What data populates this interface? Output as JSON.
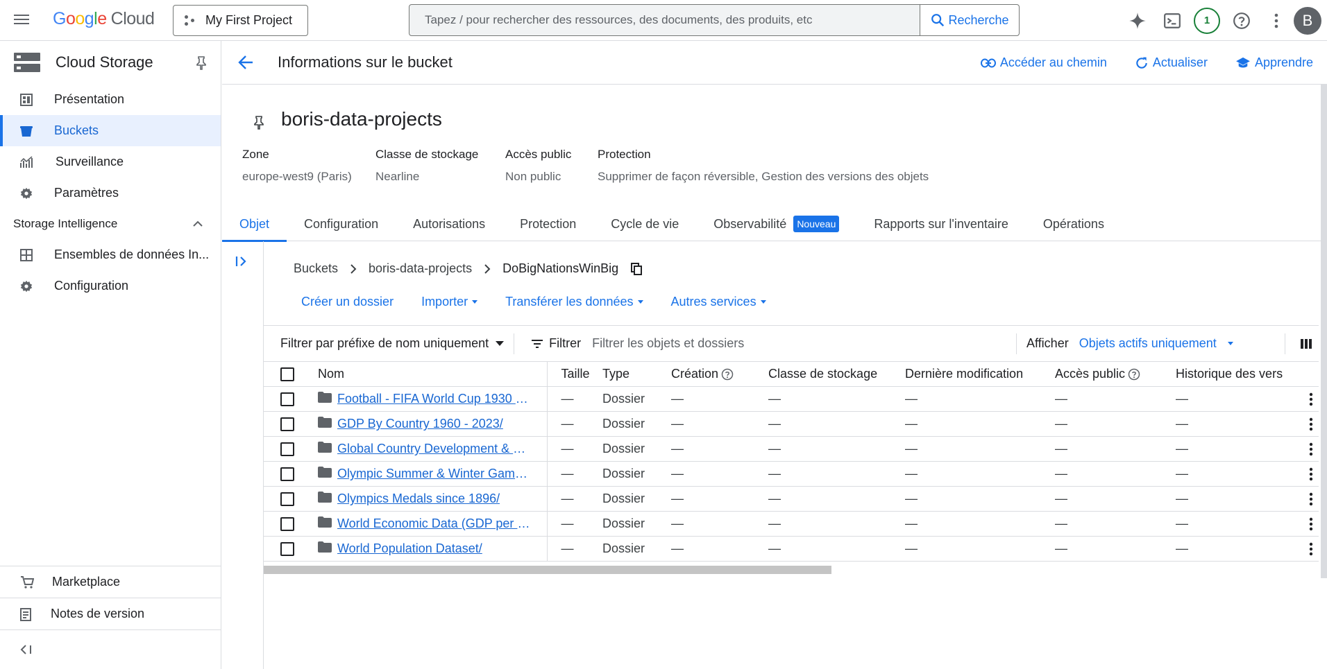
{
  "topbar": {
    "logo_letters": [
      "G",
      "o",
      "o",
      "g",
      "l",
      "e"
    ],
    "logo_suffix": "Cloud",
    "project": "My First Project",
    "search_placeholder": "Tapez / pour rechercher des ressources, des documents, des produits, etc",
    "search_button": "Recherche",
    "notifications_count": "1",
    "avatar_letter": "B"
  },
  "sidebar": {
    "title": "Cloud Storage",
    "items": [
      {
        "label": "Présentation",
        "icon": "dashboard-icon"
      },
      {
        "label": "Buckets",
        "icon": "bucket-icon",
        "active": true
      },
      {
        "label": "Surveillance",
        "icon": "monitoring-icon"
      },
      {
        "label": "Paramètres",
        "icon": "gear-icon"
      }
    ],
    "section": "Storage Intelligence",
    "section_items": [
      {
        "label": "Ensembles de données In...",
        "icon": "dataset-icon"
      },
      {
        "label": "Configuration",
        "icon": "gear-icon"
      }
    ],
    "bottom": [
      {
        "label": "Marketplace",
        "icon": "cart-icon"
      },
      {
        "label": "Notes de version",
        "icon": "notes-icon"
      }
    ]
  },
  "header": {
    "title": "Informations sur le bucket",
    "actions": [
      "Accéder au chemin",
      "Actualiser",
      "Apprendre"
    ]
  },
  "bucket": {
    "name": "boris-data-projects",
    "props": [
      {
        "key": "Zone",
        "value": "europe-west9 (Paris)"
      },
      {
        "key": "Classe de stockage",
        "value": "Nearline"
      },
      {
        "key": "Accès public",
        "value": "Non public"
      },
      {
        "key": "Protection",
        "value": "Supprimer de façon réversible, Gestion des versions des objets"
      }
    ]
  },
  "tabs": [
    "Objet",
    "Configuration",
    "Autorisations",
    "Protection",
    "Cycle de vie",
    "Observabilité",
    "Rapports sur l'inventaire",
    "Opérations"
  ],
  "tab_new_badge": "Nouveau",
  "breadcrumb": [
    "Buckets",
    "boris-data-projects",
    "DoBigNationsWinBig"
  ],
  "object_actions": [
    "Créer un dossier",
    "Importer",
    "Transférer les données",
    "Autres services"
  ],
  "filter": {
    "prefix": "Filtrer par préfixe de nom uniquement",
    "label": "Filtrer",
    "placeholder": "Filtrer les objets et dossiers",
    "show_label": "Afficher",
    "show_value": "Objets actifs uniquement"
  },
  "table": {
    "columns": [
      "Nom",
      "Taille",
      "Type",
      "Création",
      "Classe de stockage",
      "Dernière modification",
      "Accès public",
      "Historique des vers"
    ],
    "rows": [
      {
        "name": "Football - FIFA World Cup 1930 - 2...",
        "size": "—",
        "type": "Dossier",
        "created": "—",
        "class": "—",
        "modified": "—",
        "public": "—",
        "history": "—"
      },
      {
        "name": "GDP By Country 1960 - 2023/",
        "size": "—",
        "type": "Dossier",
        "created": "—",
        "class": "—",
        "modified": "—",
        "public": "—",
        "history": "—"
      },
      {
        "name": "Global Country Development & Pro...",
        "size": "—",
        "type": "Dossier",
        "created": "—",
        "class": "—",
        "modified": "—",
        "public": "—",
        "history": "—"
      },
      {
        "name": "Olympic Summer & Winter Games ...",
        "size": "—",
        "type": "Dossier",
        "created": "—",
        "class": "—",
        "modified": "—",
        "public": "—",
        "history": "—"
      },
      {
        "name": "Olympics Medals since 1896/",
        "size": "—",
        "type": "Dossier",
        "created": "—",
        "class": "—",
        "modified": "—",
        "public": "—",
        "history": "—"
      },
      {
        "name": "World Economic Data (GDP per ca...",
        "size": "—",
        "type": "Dossier",
        "created": "—",
        "class": "—",
        "modified": "—",
        "public": "—",
        "history": "—"
      },
      {
        "name": "World Population Dataset/",
        "size": "—",
        "type": "Dossier",
        "created": "—",
        "class": "—",
        "modified": "—",
        "public": "—",
        "history": "—"
      }
    ]
  },
  "colors": {
    "accent": "#1a73e8",
    "active_bg": "#e8f0fe",
    "text": "#202124",
    "muted": "#5f6368"
  }
}
